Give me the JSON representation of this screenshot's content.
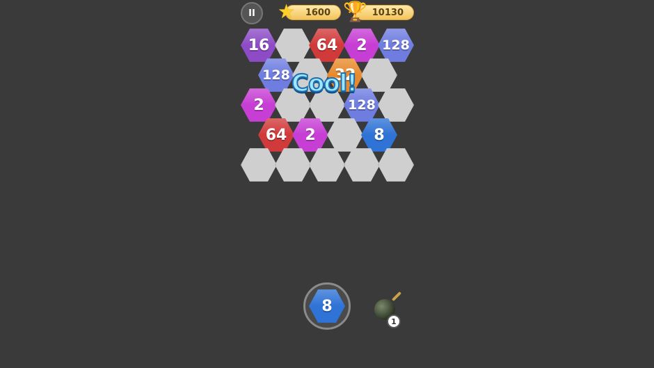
{
  "hud": {
    "pause_label": "II",
    "stars": "1600",
    "best_score": "10130",
    "star_icon": "star-icon",
    "trophy_icon": "trophy-icon"
  },
  "combo_text": "Cool!",
  "tile_colors": {
    "2": "#c63ed3",
    "8": "#2f73d6",
    "16": "#8d4cc6",
    "32": "#e78a2d",
    "64": "#d13a3a",
    "128": "#6f7de0",
    "empty": "#cfcfcf"
  },
  "board": {
    "tiles": [
      {
        "value": "16"
      },
      {
        "value": ""
      },
      {
        "value": "64"
      },
      {
        "value": "2"
      },
      {
        "value": "128"
      },
      {
        "value": "128"
      },
      {
        "value": ""
      },
      {
        "value": "32"
      },
      {
        "value": ""
      },
      {
        "value": "2"
      },
      {
        "value": ""
      },
      {
        "value": ""
      },
      {
        "value": "128"
      },
      {
        "value": ""
      },
      {
        "value": "64"
      },
      {
        "value": "2"
      },
      {
        "value": ""
      },
      {
        "value": "8"
      },
      {
        "value": ""
      },
      {
        "value": ""
      },
      {
        "value": ""
      },
      {
        "value": ""
      },
      {
        "value": ""
      }
    ]
  },
  "next_tile": {
    "value": "8"
  },
  "bomb": {
    "count": "1",
    "icon": "bomb-icon"
  }
}
